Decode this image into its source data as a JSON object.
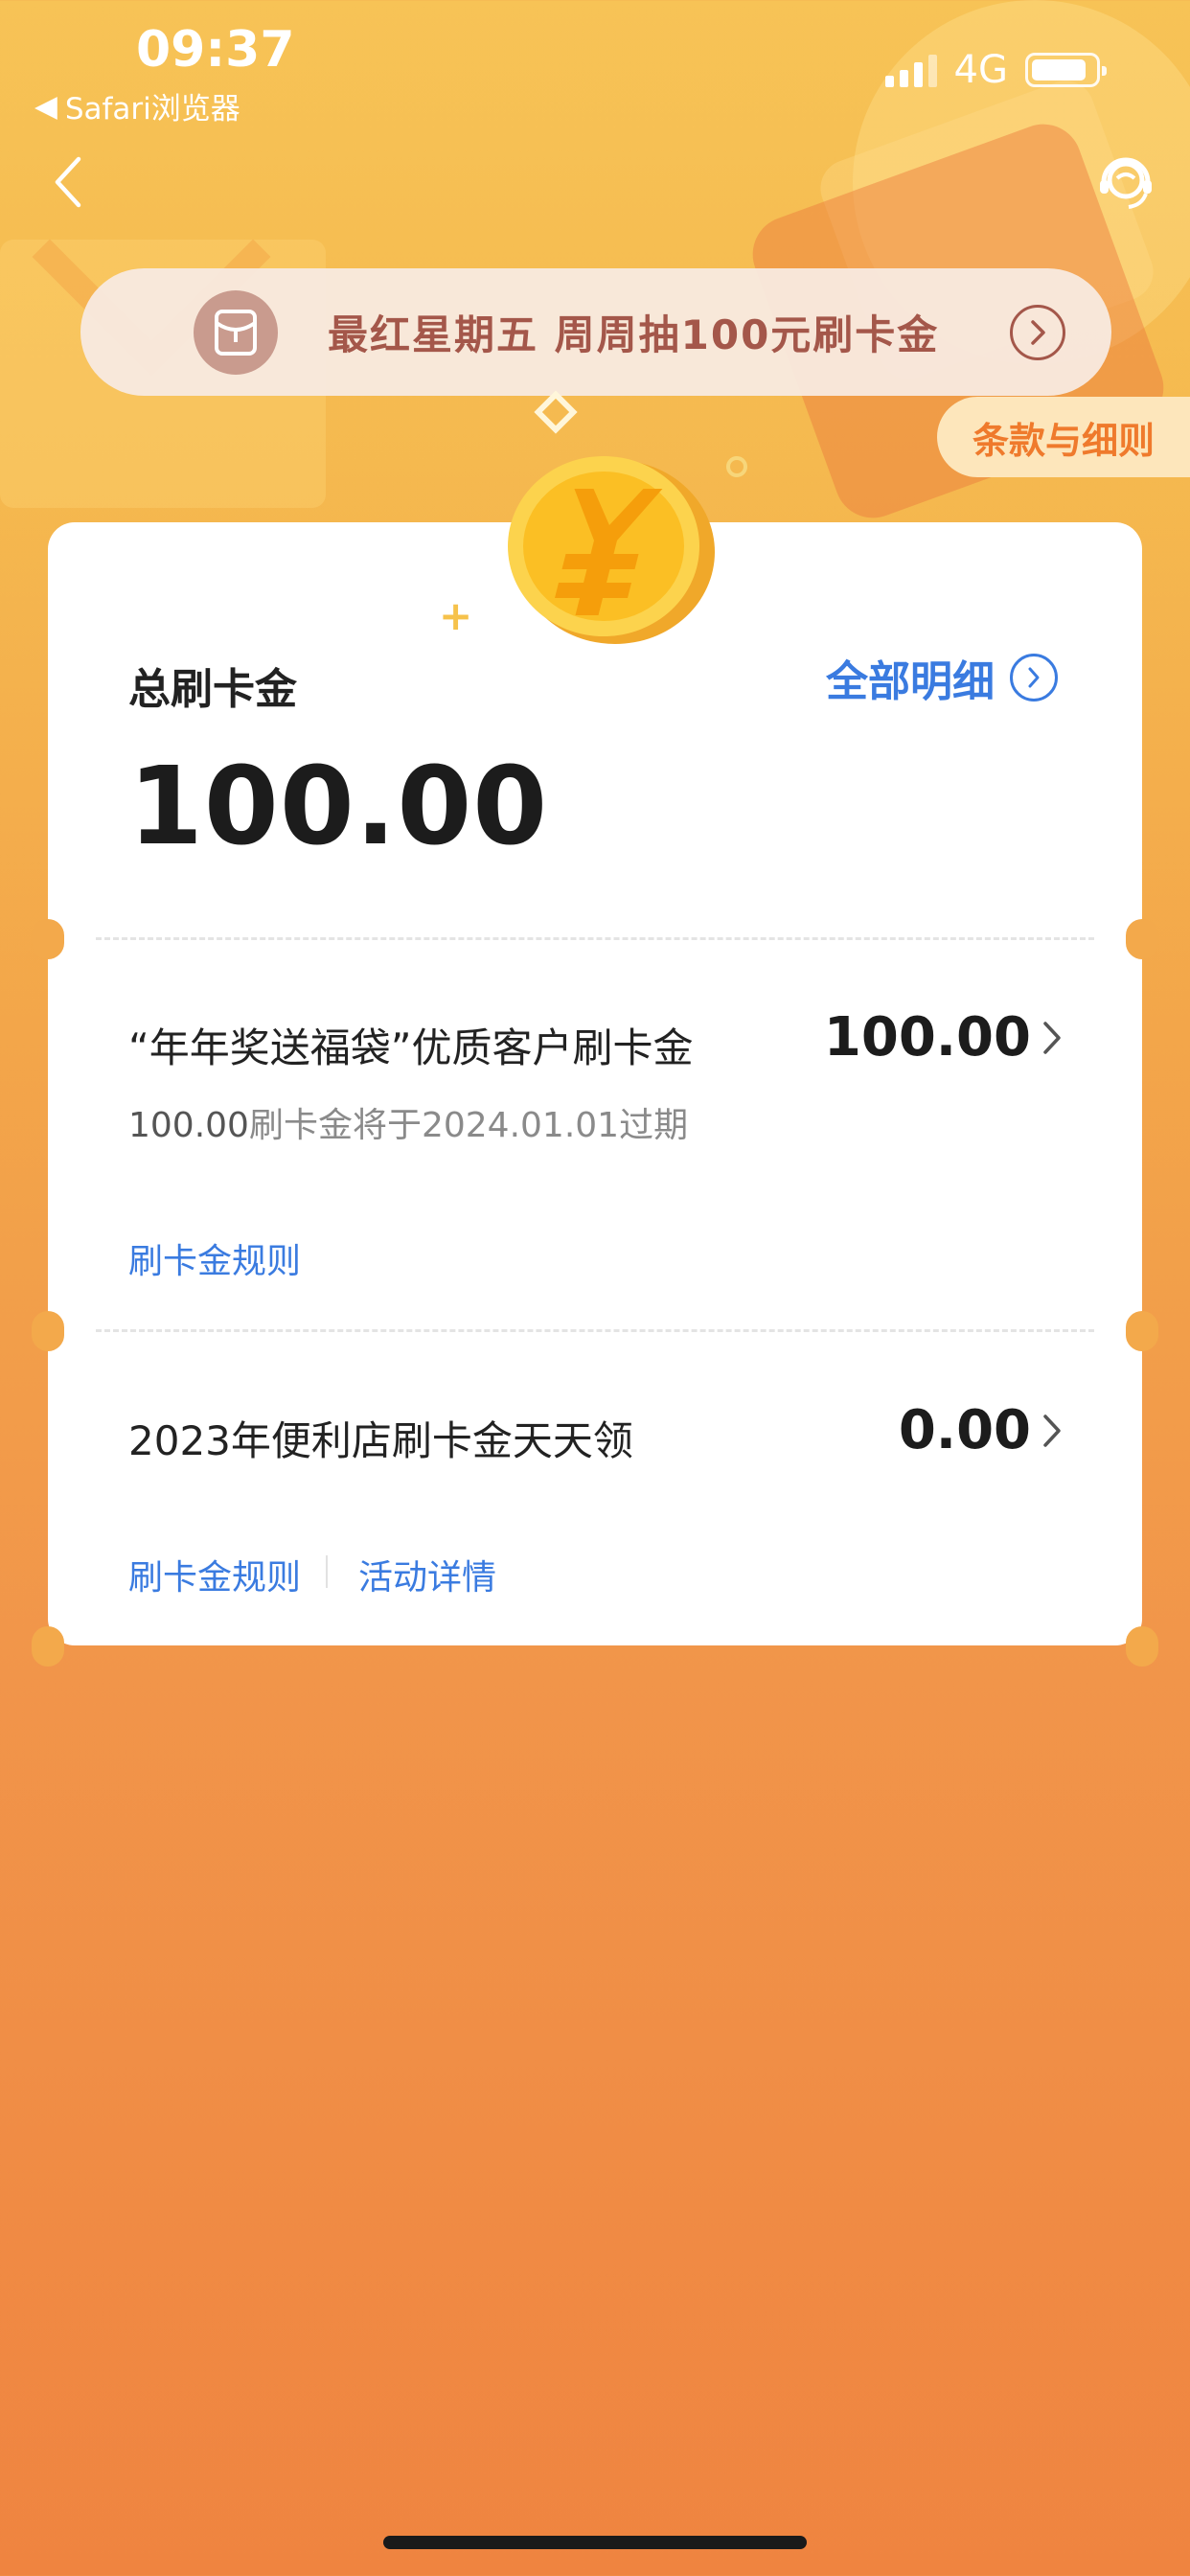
{
  "status_bar": {
    "time": "09:37",
    "back_app": "Safari浏览器",
    "network": "4G"
  },
  "nav": {
    "back_icon": "chevron-left-icon",
    "service_icon": "customer-service-icon"
  },
  "promo": {
    "text": "最红星期五 周周抽100元刷卡金",
    "icon": "red-envelope-icon"
  },
  "terms_label": "条款与细则",
  "summary": {
    "label": "总刷卡金",
    "amount": "100.00",
    "detail_link": "全部明细"
  },
  "items": [
    {
      "title": "“年年奖送福袋”优质客户刷卡金",
      "amount": "100.00",
      "expiry_amount": "100.00",
      "expiry_text": "刷卡金将于2024.01.01过期",
      "links": [
        "刷卡金规则"
      ]
    },
    {
      "title": "2023年便利店刷卡金天天领",
      "amount": "0.00",
      "links": [
        "刷卡金规则",
        "活动详情"
      ]
    }
  ],
  "colors": {
    "accent_blue": "#3a7be0",
    "bg_orange": "#f1954a",
    "promo_text": "#a4574a",
    "terms_text": "#ef7a2c"
  }
}
